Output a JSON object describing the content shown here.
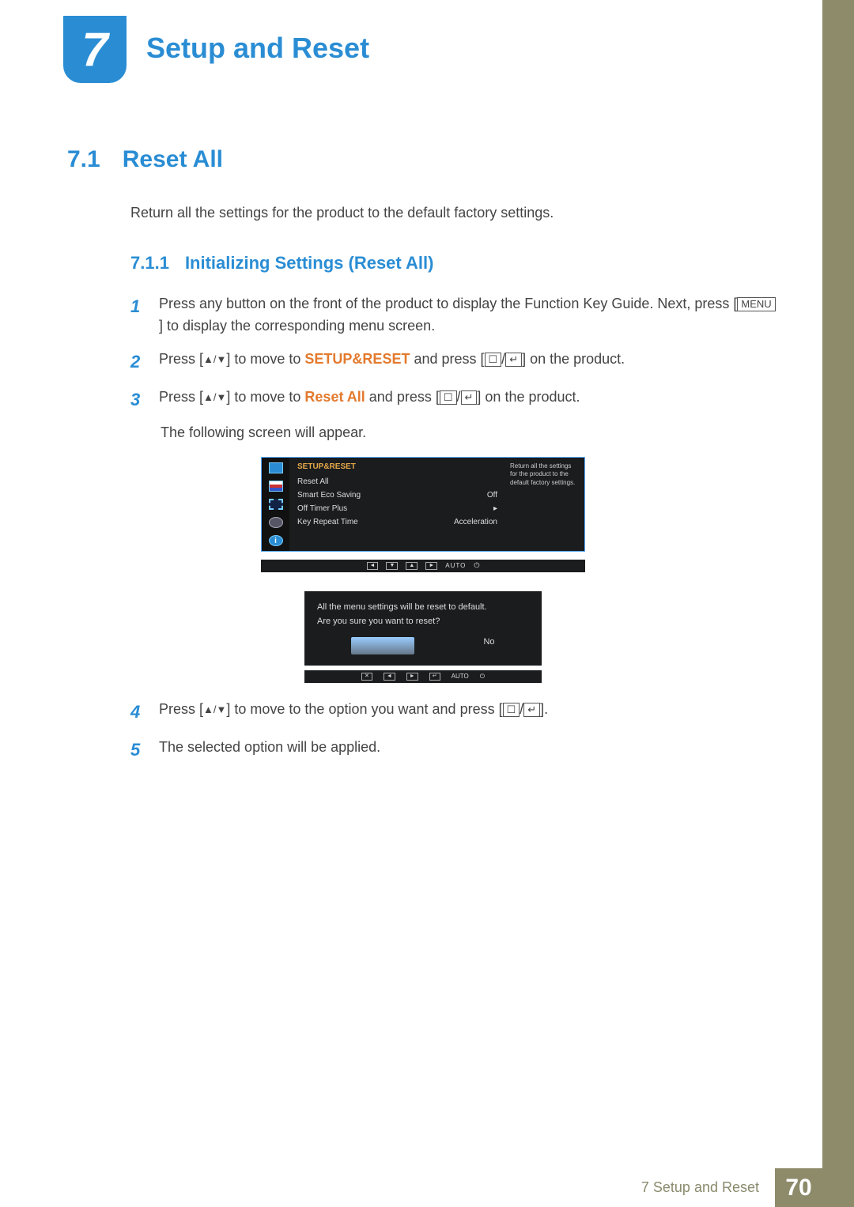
{
  "chapter": {
    "number": "7",
    "title": "Setup and Reset"
  },
  "section": {
    "number": "7.1",
    "title": "Reset All"
  },
  "description": "Return all the settings for the product to the default factory settings.",
  "subsection": {
    "number": "7.1.1",
    "title": "Initializing Settings (Reset All)"
  },
  "steps": {
    "s1": {
      "num": "1",
      "t1": "Press any button on the front of the product to display the Function Key Guide. Next, press [",
      "menu": "MENU",
      "t2": "] to display the corresponding menu screen."
    },
    "s2": {
      "num": "2",
      "t1": "Press [",
      "arrows": "▲/▼",
      "t2": "] to move to ",
      "hl": "SETUP&RESET",
      "t3": " and press [",
      "btn1": "☐",
      "slash": "/",
      "btn2": "↵",
      "t4": "] on the product."
    },
    "s3": {
      "num": "3",
      "t1": "Press [",
      "arrows": "▲/▼",
      "t2": "] to move to ",
      "hl": "Reset All",
      "t3": " and press [",
      "btn1": "☐",
      "slash": "/",
      "btn2": "↵",
      "t4": "] on the product."
    },
    "s3_sub": "The following screen will appear.",
    "s4": {
      "num": "4",
      "t1": "Press [",
      "arrows": "▲/▼",
      "t2": "] to move to the option you want and press [",
      "btn1": "☐",
      "slash": "/",
      "btn2": "↵",
      "t3": "]."
    },
    "s5": {
      "num": "5",
      "t1": "The selected option will be applied."
    }
  },
  "osd1": {
    "title": "SETUP&RESET",
    "rows": [
      {
        "l": "Reset All",
        "r": ""
      },
      {
        "l": "Smart Eco Saving",
        "r": "Off"
      },
      {
        "l": "Off Timer Plus",
        "r": "▸"
      },
      {
        "l": "Key Repeat Time",
        "r": "Acceleration"
      }
    ],
    "hint": "Return all the settings for the product to the default factory settings.",
    "info_glyph": "i"
  },
  "osd_bar": {
    "b1": "◄",
    "b2": "▼",
    "b3": "▲",
    "b4": "►",
    "auto": "AUTO",
    "pwr": "⏻"
  },
  "osd2": {
    "line1": "All the menu settings will be reset to default.",
    "line2": "Are you sure you want to reset?",
    "no": "No"
  },
  "osd_bar2": {
    "b1": "✕",
    "b2": "◄",
    "b3": "►",
    "b4": "↵",
    "auto": "AUTO",
    "pwr": "⏻"
  },
  "footer": {
    "text": "7 Setup and Reset",
    "page": "70"
  }
}
